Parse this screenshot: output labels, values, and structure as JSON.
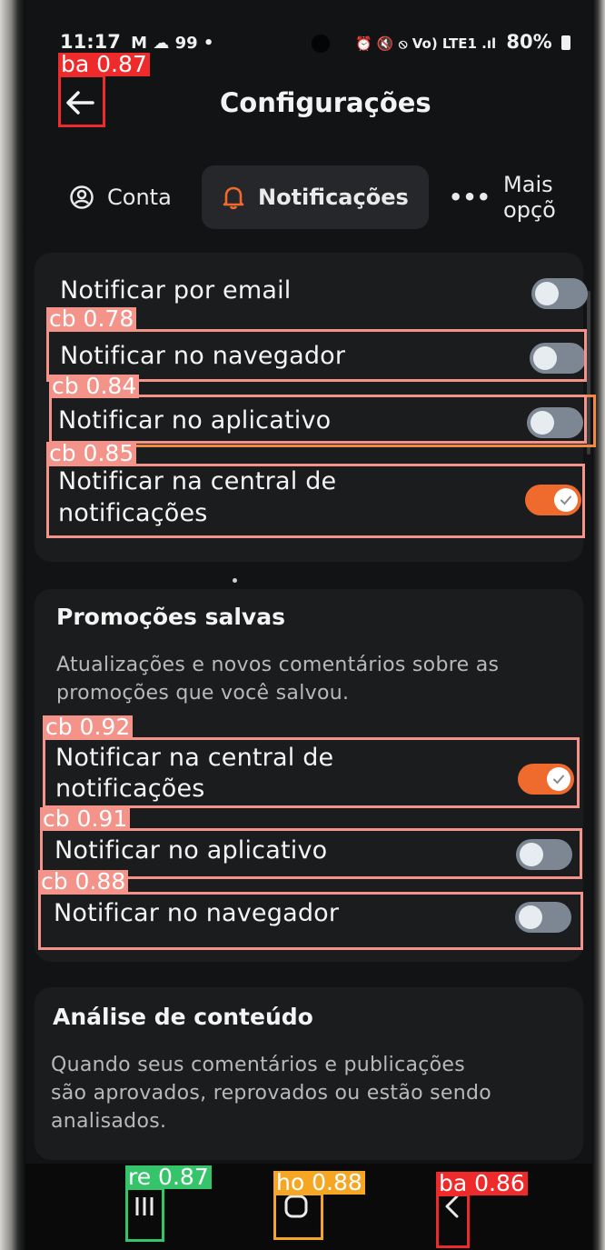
{
  "status_bar": {
    "time": "11:17",
    "left_icons": "M ☁ 99 •",
    "right_icons": "⏰ 🔇 ⦸ Vo) LTE1 .ıl",
    "battery": "80%"
  },
  "header": {
    "title": "Configurações",
    "back_icon": "arrow-left-icon"
  },
  "tabs": [
    {
      "label": "Conta",
      "icon": "user-circle-icon",
      "active": false
    },
    {
      "label": "Notificações",
      "icon": "bell-icon",
      "active": true
    },
    {
      "label": "Mais opçõ",
      "icon": "more-dots-icon",
      "active": false
    }
  ],
  "section_general": {
    "rows": [
      {
        "label": "Notificar por email",
        "enabled": false
      },
      {
        "label": "Notificar no navegador",
        "enabled": false
      },
      {
        "label": "Notificar no aplicativo",
        "enabled": false
      },
      {
        "label_line1": "Notificar na central de",
        "label_line2": "notificações",
        "enabled": true
      }
    ]
  },
  "section_promocoes": {
    "title": "Promoções salvas",
    "desc_line1": "Atualizações e novos comentários sobre as",
    "desc_line2": "promoções que você salvou.",
    "rows": [
      {
        "label_line1": "Notificar na central de",
        "label_line2": "notificações",
        "enabled": true
      },
      {
        "label": "Notificar no aplicativo",
        "enabled": false
      },
      {
        "label": "Notificar no navegador",
        "enabled": false
      }
    ]
  },
  "section_analise": {
    "title": "Análise de conteúdo",
    "desc_line1": "Quando seus comentários e publicações",
    "desc_line2": "são aprovados, reprovados ou estão sendo",
    "desc_line3": "analisados."
  },
  "detections": [
    {
      "label": "ba 0.87",
      "color": "#ee2a2a"
    },
    {
      "label": "cb 0.78",
      "color": "#f4938a"
    },
    {
      "label": "cb 0.84",
      "color": "#f4938a"
    },
    {
      "label": "cb 0.85",
      "color": "#f4938a"
    },
    {
      "label": "cb 0.92",
      "color": "#f4938a"
    },
    {
      "label": "cb 0.91",
      "color": "#f4938a"
    },
    {
      "label": "cb 0.88",
      "color": "#f4938a"
    },
    {
      "label": "re 0.87",
      "color": "#36c46a"
    },
    {
      "label": "ho 0.88",
      "color": "#f5a623"
    },
    {
      "label": "ba 0.86",
      "color": "#ee2a2a"
    }
  ],
  "navbar": {
    "recents_icon": "recents-icon",
    "home_icon": "home-icon",
    "back_icon": "nav-back-icon"
  },
  "colors": {
    "accent": "#ef6a2d",
    "toggle_off": "#7d8794",
    "card_bg": "#1b1c1e",
    "background": "#121314"
  }
}
